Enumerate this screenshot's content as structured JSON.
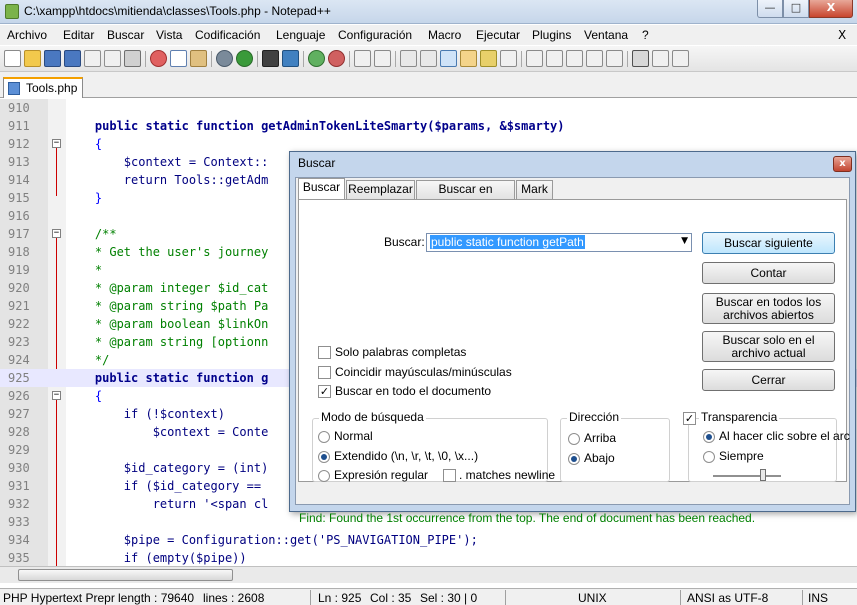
{
  "window": {
    "title": "C:\\xampp\\htdocs\\mitienda\\classes\\Tools.php - Notepad++",
    "min_glyph": "—",
    "max_glyph": "□",
    "close_glyph": "X"
  },
  "menu": {
    "items": [
      "Archivo",
      "Editar",
      "Buscar",
      "Vista",
      "Codificación",
      "Lenguaje",
      "Configuración",
      "Macro",
      "Ejecutar",
      "Plugins",
      "Ventana",
      "?"
    ],
    "close_doc": "X"
  },
  "toolbar": {
    "icons": [
      "new-file-icon",
      "open-file-icon",
      "save-icon",
      "save-all-icon",
      "close-icon",
      "close-all-icon",
      "print-icon",
      "cut-icon",
      "copy-icon",
      "paste-icon",
      "undo-icon",
      "redo-icon",
      "find-icon",
      "replace-icon",
      "zoom-in-icon",
      "zoom-out-icon",
      "sync-v-icon",
      "sync-h-icon",
      "word-wrap-icon",
      "show-all-chars-icon",
      "indent-guide-icon",
      "doc-map-icon",
      "function-list-icon",
      "folder-workspace-icon",
      "record-macro-icon",
      "stop-macro-icon",
      "play-macro-icon",
      "play-multiple-icon",
      "save-macro-icon",
      "ds-icon",
      "spellcheck-icon",
      "spellcheck-auto-icon"
    ]
  },
  "tabs": [
    {
      "label": "Tools.php"
    }
  ],
  "editor": {
    "lines": [
      {
        "n": "910",
        "code": ""
      },
      {
        "n": "911",
        "code": "    public static function getAdminTokenLiteSmarty($params, &$smarty)"
      },
      {
        "n": "912",
        "code": "    {"
      },
      {
        "n": "913",
        "code": "        $context = Context::"
      },
      {
        "n": "914",
        "code": "        return Tools::getAdm"
      },
      {
        "n": "915",
        "code": "    }"
      },
      {
        "n": "916",
        "code": ""
      },
      {
        "n": "917",
        "code": "    /**"
      },
      {
        "n": "918",
        "code": "    * Get the user's journey"
      },
      {
        "n": "919",
        "code": "    *"
      },
      {
        "n": "920",
        "code": "    * @param integer $id_cat"
      },
      {
        "n": "921",
        "code": "    * @param string $path Pa"
      },
      {
        "n": "922",
        "code": "    * @param boolean $linkOn"
      },
      {
        "n": "923",
        "code": "    * @param string [optionn"
      },
      {
        "n": "924",
        "code": "    */"
      },
      {
        "n": "925",
        "code": "    public static function g"
      },
      {
        "n": "926",
        "code": "    {"
      },
      {
        "n": "927",
        "code": "        if (!$context)"
      },
      {
        "n": "928",
        "code": "            $context = Conte"
      },
      {
        "n": "929",
        "code": ""
      },
      {
        "n": "930",
        "code": "        $id_category = (int)"
      },
      {
        "n": "931",
        "code": "        if ($id_category =="
      },
      {
        "n": "932",
        "code": "            return '<span cl"
      },
      {
        "n": "933",
        "code": ""
      },
      {
        "n": "934",
        "code": "        $pipe = Configuration::get('PS_NAVIGATION_PIPE');"
      },
      {
        "n": "935",
        "code": "        if (empty($pipe))"
      }
    ],
    "current_line": "925"
  },
  "status": {
    "language": "PHP Hypertext Prepr",
    "length": "length : 79640",
    "lines": "lines : 2608",
    "ln": "Ln : 925",
    "col": "Col : 35",
    "sel": "Sel : 30 | 0",
    "eol": "UNIX",
    "encoding": "ANSI as UTF-8",
    "mode": "INS"
  },
  "dialog": {
    "title": "Buscar",
    "close": "x",
    "tabs": [
      "Buscar",
      "Reemplazar",
      "Buscar en archivos",
      "Mark"
    ],
    "find_label": "Buscar:",
    "find_value": "public static function getPath",
    "buttons": {
      "find_next": "Buscar siguiente",
      "count": "Contar",
      "find_all_open": "Buscar en todos los archivos abiertos",
      "find_in_current": "Buscar solo en el archivo actual",
      "close": "Cerrar"
    },
    "options": {
      "whole_word": "Solo palabras completas",
      "match_case": "Coincidir mayúsculas/minúsculas",
      "wrap_around": "Buscar en todo el documento"
    },
    "search_mode": {
      "title": "Modo de búsqueda",
      "normal": "Normal",
      "extended": "Extendido (\\n, \\r, \\t, \\0, \\x...)",
      "regex": "Expresión regular",
      "matches_newline": ". matches newline"
    },
    "direction": {
      "title": "Dirección",
      "up": "Arriba",
      "down": "Abajo"
    },
    "transparency": {
      "title": "Transparencia",
      "on_lose_focus": "Al hacer clic sobre el arc",
      "always": "Siempre",
      "level": 0.75
    },
    "status": "Find: Found the 1st occurrence from the top. The end of document has been reached."
  }
}
